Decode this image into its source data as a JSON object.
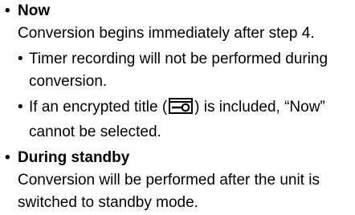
{
  "sections": [
    {
      "bullet": "•",
      "heading": "Now",
      "body": "Conversion begins immediately after step 4.",
      "notes": [
        {
          "bullet": "•",
          "text": "Timer recording will not be performed during conversion."
        },
        {
          "bullet": "•",
          "text_before": "If an encrypted title (",
          "icon": "encrypted-title-icon",
          "text_after": ") is included, “Now” cannot be selected."
        }
      ]
    },
    {
      "bullet": "•",
      "heading": "During standby",
      "body": "Conversion will be performed after the unit is switched to standby mode."
    }
  ]
}
